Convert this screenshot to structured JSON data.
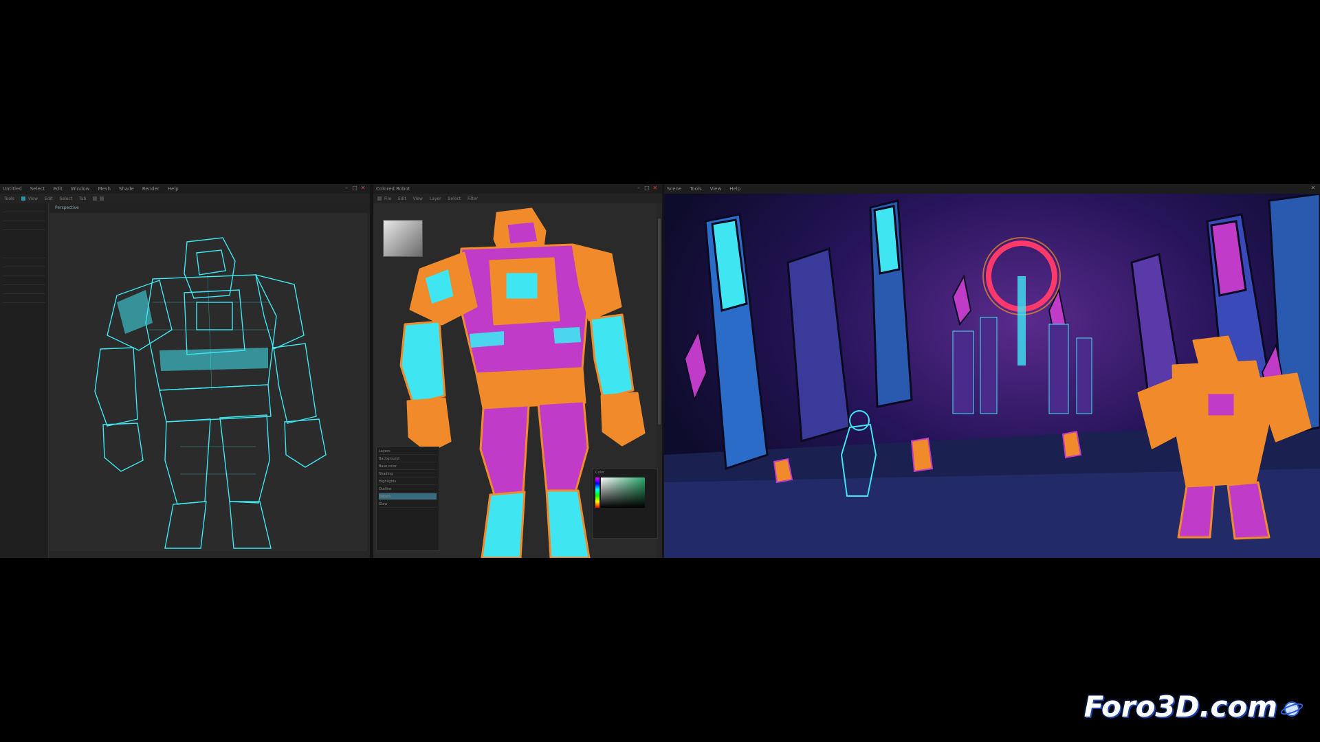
{
  "watermark": "Foro3D.com",
  "left_window": {
    "menus": [
      "Untitled",
      "Select",
      "Edit",
      "Window",
      "Mesh",
      "Shade",
      "Render",
      "Help"
    ],
    "toolbar": [
      "Tools",
      "View",
      "Edit",
      "Select",
      "Tab"
    ],
    "viewport_tab": "Perspective",
    "icon": "robot-wireframe"
  },
  "middle_window": {
    "title": "Colored Robot",
    "toolbar": [
      "File",
      "Edit",
      "View",
      "Layer",
      "Select",
      "Filter"
    ],
    "layers_panel_title": "Layers",
    "layers": [
      "Background",
      "Base color",
      "Shading",
      "Highlights",
      "Outline",
      "Details",
      "Glow"
    ],
    "color_picker_title": "Color",
    "icon": "robot-colored"
  },
  "right_window": {
    "menus": [
      "Scene",
      "Tools",
      "View",
      "Help"
    ],
    "icon": "game-scene"
  },
  "colors": {
    "cyan": "#3fe6f2",
    "magenta": "#c03cc8",
    "orange": "#f08a2a",
    "background": "#000000"
  }
}
